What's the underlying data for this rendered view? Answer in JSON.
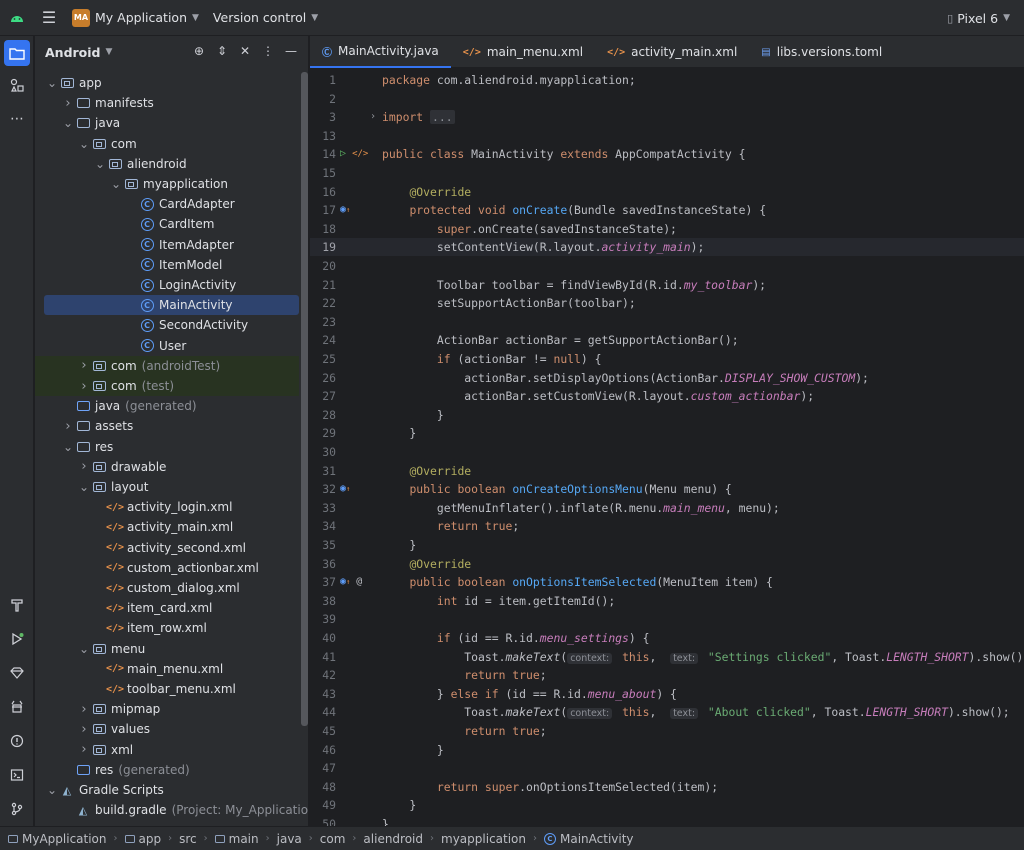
{
  "topbar": {
    "project_badge": "MA",
    "project_name": "My Application",
    "version_control": "Version control",
    "device": "Pixel 6"
  },
  "project_panel": {
    "view_mode": "Android",
    "tree": [
      {
        "label": "app",
        "suffix": "",
        "depth": 0,
        "expanded": true,
        "icon": "module-folder"
      },
      {
        "label": "manifests",
        "suffix": "",
        "depth": 1,
        "expanded": false,
        "icon": "folder"
      },
      {
        "label": "java",
        "suffix": "",
        "depth": 1,
        "expanded": true,
        "icon": "folder"
      },
      {
        "label": "com",
        "suffix": "",
        "depth": 2,
        "expanded": true,
        "icon": "package"
      },
      {
        "label": "aliendroid",
        "suffix": "",
        "depth": 3,
        "expanded": true,
        "icon": "package"
      },
      {
        "label": "myapplication",
        "suffix": "",
        "depth": 4,
        "expanded": true,
        "icon": "package"
      },
      {
        "label": "CardAdapter",
        "suffix": "",
        "depth": 5,
        "icon": "class"
      },
      {
        "label": "CardItem",
        "suffix": "",
        "depth": 5,
        "icon": "class"
      },
      {
        "label": "ItemAdapter",
        "suffix": "",
        "depth": 5,
        "icon": "class"
      },
      {
        "label": "ItemModel",
        "suffix": "",
        "depth": 5,
        "icon": "class"
      },
      {
        "label": "LoginActivity",
        "suffix": "",
        "depth": 5,
        "icon": "class"
      },
      {
        "label": "MainActivity",
        "suffix": "",
        "depth": 5,
        "icon": "class",
        "selected": true
      },
      {
        "label": "SecondActivity",
        "suffix": "",
        "depth": 5,
        "icon": "class"
      },
      {
        "label": "User",
        "suffix": "",
        "depth": 5,
        "icon": "class"
      },
      {
        "label": "com",
        "suffix": "(androidTest)",
        "depth": 2,
        "expanded": false,
        "icon": "package",
        "highlight": true
      },
      {
        "label": "com",
        "suffix": "(test)",
        "depth": 2,
        "expanded": false,
        "icon": "package",
        "highlight": true
      },
      {
        "label": "java",
        "suffix": "(generated)",
        "depth": 1,
        "icon": "folder-gen"
      },
      {
        "label": "assets",
        "suffix": "",
        "depth": 1,
        "expanded": false,
        "icon": "folder"
      },
      {
        "label": "res",
        "suffix": "",
        "depth": 1,
        "expanded": true,
        "icon": "folder"
      },
      {
        "label": "drawable",
        "suffix": "",
        "depth": 2,
        "expanded": false,
        "icon": "package"
      },
      {
        "label": "layout",
        "suffix": "",
        "depth": 2,
        "expanded": true,
        "icon": "package"
      },
      {
        "label": "activity_login.xml",
        "suffix": "",
        "depth": 3,
        "icon": "xml"
      },
      {
        "label": "activity_main.xml",
        "suffix": "",
        "depth": 3,
        "icon": "xml"
      },
      {
        "label": "activity_second.xml",
        "suffix": "",
        "depth": 3,
        "icon": "xml"
      },
      {
        "label": "custom_actionbar.xml",
        "suffix": "",
        "depth": 3,
        "icon": "xml"
      },
      {
        "label": "custom_dialog.xml",
        "suffix": "",
        "depth": 3,
        "icon": "xml"
      },
      {
        "label": "item_card.xml",
        "suffix": "",
        "depth": 3,
        "icon": "xml"
      },
      {
        "label": "item_row.xml",
        "suffix": "",
        "depth": 3,
        "icon": "xml"
      },
      {
        "label": "menu",
        "suffix": "",
        "depth": 2,
        "expanded": true,
        "icon": "package"
      },
      {
        "label": "main_menu.xml",
        "suffix": "",
        "depth": 3,
        "icon": "xml"
      },
      {
        "label": "toolbar_menu.xml",
        "suffix": "",
        "depth": 3,
        "icon": "xml"
      },
      {
        "label": "mipmap",
        "suffix": "",
        "depth": 2,
        "expanded": false,
        "icon": "package"
      },
      {
        "label": "values",
        "suffix": "",
        "depth": 2,
        "expanded": false,
        "icon": "package"
      },
      {
        "label": "xml",
        "suffix": "",
        "depth": 2,
        "expanded": false,
        "icon": "package"
      },
      {
        "label": "res",
        "suffix": "(generated)",
        "depth": 1,
        "icon": "folder-gen"
      },
      {
        "label": "Gradle Scripts",
        "suffix": "",
        "depth": 0,
        "expanded": true,
        "icon": "gradle"
      },
      {
        "label": "build.gradle",
        "suffix": "(Project: My_Application)",
        "depth": 1,
        "icon": "gradle"
      }
    ]
  },
  "tabs": [
    {
      "label": "MainActivity.java",
      "icon": "class-icon",
      "active": true
    },
    {
      "label": "main_menu.xml",
      "icon": "xml-icon"
    },
    {
      "label": "activity_main.xml",
      "icon": "xml-icon"
    },
    {
      "label": "libs.versions.toml",
      "icon": "toml-icon"
    }
  ],
  "editor": {
    "current_line": "19",
    "lines": [
      {
        "n": "1",
        "html": "<span class='kw'>package</span> com.aliendroid.myapplication;"
      },
      {
        "n": "2",
        "html": ""
      },
      {
        "n": "3",
        "html": "<span class='kw'>import</span> <span class='fold'>...</span>",
        "fold": "›"
      },
      {
        "n": "13",
        "html": ""
      },
      {
        "n": "14",
        "html": "<span class='kw'>public class</span> MainActivity <span class='kw'>extends</span> AppCompatActivity {",
        "gutter": "run"
      },
      {
        "n": "15",
        "html": ""
      },
      {
        "n": "16",
        "html": "    <span class='an'>@Override</span>"
      },
      {
        "n": "17",
        "html": "    <span class='kw'>protected void</span> <span class='fn'>onCreate</span>(Bundle savedInstanceState) {",
        "gutter": "override"
      },
      {
        "n": "18",
        "html": "        <span class='kw'>super</span>.onCreate(savedInstanceState);"
      },
      {
        "n": "19",
        "html": "        setContentView(R.layout.<span class='fi'>activity_main</span>);"
      },
      {
        "n": "20",
        "html": ""
      },
      {
        "n": "21",
        "html": "        Toolbar toolbar = findViewById(R.id.<span class='fi'>my_toolbar</span>);"
      },
      {
        "n": "22",
        "html": "        setSupportActionBar(toolbar);"
      },
      {
        "n": "23",
        "html": ""
      },
      {
        "n": "24",
        "html": "        ActionBar actionBar = getSupportActionBar();"
      },
      {
        "n": "25",
        "html": "        <span class='kw'>if</span> (actionBar != <span class='kw'>null</span>) {"
      },
      {
        "n": "26",
        "html": "            actionBar.setDisplayOptions(ActionBar.<span class='fi'>DISPLAY_SHOW_CUSTOM</span>);"
      },
      {
        "n": "27",
        "html": "            actionBar.setCustomView(R.layout.<span class='fi'>custom_actionbar</span>);"
      },
      {
        "n": "28",
        "html": "        }"
      },
      {
        "n": "29",
        "html": "    }"
      },
      {
        "n": "30",
        "html": ""
      },
      {
        "n": "31",
        "html": "    <span class='an'>@Override</span>"
      },
      {
        "n": "32",
        "html": "    <span class='kw'>public boolean</span> <span class='fn'>onCreateOptionsMenu</span>(Menu menu) {",
        "gutter": "override"
      },
      {
        "n": "33",
        "html": "        getMenuInflater().inflate(R.menu.<span class='fi'>main_menu</span>, menu);"
      },
      {
        "n": "34",
        "html": "        <span class='kw'>return true</span>;"
      },
      {
        "n": "35",
        "html": "    }"
      },
      {
        "n": "36",
        "html": "    <span class='an'>@Override</span>"
      },
      {
        "n": "37",
        "html": "    <span class='kw'>public boolean</span> <span class='fn'>onOptionsItemSelected</span>(MenuItem item) {",
        "gutter": "override-at"
      },
      {
        "n": "38",
        "html": "        <span class='kw'>int</span> id = item.getItemId();"
      },
      {
        "n": "39",
        "html": ""
      },
      {
        "n": "40",
        "html": "        <span class='kw'>if</span> (id == R.id.<span class='fi'>menu_settings</span>) {"
      },
      {
        "n": "41",
        "html": "            Toast.<span class='sm'>makeText</span>(<span class='hint'>context:</span> <span class='kw'>this</span>,  <span class='hint'>text:</span> <span class='st'>\"Settings clicked\"</span>, Toast.<span class='fi'>LENGTH_SHORT</span>).show();"
      },
      {
        "n": "42",
        "html": "            <span class='kw'>return true</span>;"
      },
      {
        "n": "43",
        "html": "        } <span class='kw'>else if</span> (id == R.id.<span class='fi'>menu_about</span>) {"
      },
      {
        "n": "44",
        "html": "            Toast.<span class='sm'>makeText</span>(<span class='hint'>context:</span> <span class='kw'>this</span>,  <span class='hint'>text:</span> <span class='st'>\"About clicked\"</span>, Toast.<span class='fi'>LENGTH_SHORT</span>).show();"
      },
      {
        "n": "45",
        "html": "            <span class='kw'>return true</span>;"
      },
      {
        "n": "46",
        "html": "        }"
      },
      {
        "n": "47",
        "html": ""
      },
      {
        "n": "48",
        "html": "        <span class='kw'>return super</span>.onOptionsItemSelected(item);"
      },
      {
        "n": "49",
        "html": "    }"
      },
      {
        "n": "50",
        "html": "}"
      }
    ]
  },
  "statusbar": {
    "breadcrumb": [
      {
        "label": "MyApplication",
        "icon": "module"
      },
      {
        "label": "app",
        "icon": "module"
      },
      {
        "label": "src",
        "icon": ""
      },
      {
        "label": "main",
        "icon": "module"
      },
      {
        "label": "java",
        "icon": ""
      },
      {
        "label": "com",
        "icon": ""
      },
      {
        "label": "aliendroid",
        "icon": ""
      },
      {
        "label": "myapplication",
        "icon": ""
      },
      {
        "label": "MainActivity",
        "icon": "class"
      }
    ]
  },
  "colors": {
    "accent": "#3574f0",
    "selection": "#2e436e",
    "background": "#1e1f22",
    "panel": "#2b2d30"
  }
}
